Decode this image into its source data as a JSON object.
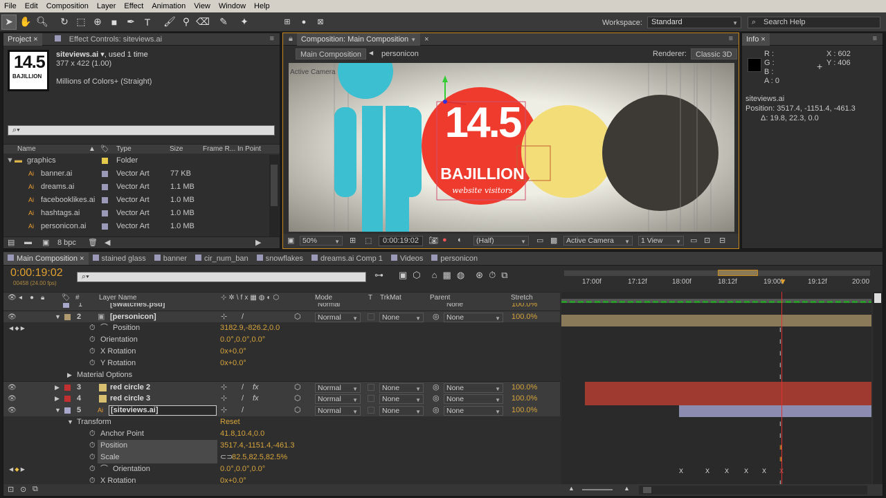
{
  "menu": [
    "File",
    "Edit",
    "Composition",
    "Layer",
    "Effect",
    "Animation",
    "View",
    "Window",
    "Help"
  ],
  "toolbar": {
    "workspace_label": "Workspace:",
    "workspace_value": "Standard",
    "search_placeholder": "Search Help"
  },
  "project": {
    "tab_project": "Project",
    "tab_effects": "Effect Controls: siteviews.ai",
    "thumb_number": "14.5",
    "thumb_word": "BAJILLION",
    "file_name": "siteviews.ai",
    "used": ", used 1 time",
    "dims": "377 x 422 (1.00)",
    "colors": "Millions of Colors+ (Straight)",
    "columns": {
      "name": "Name",
      "type": "Type",
      "size": "Size",
      "frame": "Frame R...",
      "inpoint": "In Point"
    },
    "items": [
      {
        "name": "graphics",
        "type": "Folder",
        "size": "",
        "color": "#e6c84a"
      },
      {
        "name": "banner.ai",
        "type": "Vector Art",
        "size": "77 KB",
        "color": "#9a9ab8"
      },
      {
        "name": "dreams.ai",
        "type": "Vector Art",
        "size": "1.1 MB",
        "color": "#9a9ab8"
      },
      {
        "name": "facebooklikes.ai",
        "type": "Vector Art",
        "size": "1.0 MB",
        "color": "#9a9ab8"
      },
      {
        "name": "hashtags.ai",
        "type": "Vector Art",
        "size": "1.0 MB",
        "color": "#9a9ab8"
      },
      {
        "name": "personicon.ai",
        "type": "Vector Art",
        "size": "1.0 MB",
        "color": "#9a9ab8"
      }
    ],
    "bpc": "8 bpc"
  },
  "comp": {
    "tab": "Composition: Main Composition",
    "crumb_main": "Main Composition",
    "crumb_person": "personicon",
    "renderer_label": "Renderer:",
    "renderer_value": "Classic 3D",
    "active_camera": "Active Camera",
    "big_number": "14.5",
    "big_word": "BAJILLION",
    "script_text": "website visitors",
    "zoom": "50%",
    "timecode": "0:00:19:02",
    "resolution": "(Half)",
    "camera_select": "Active Camera",
    "view_select": "1 View"
  },
  "info": {
    "tab": "Info",
    "r": "R :",
    "g": "G :",
    "b": "B :",
    "a": "A : 0",
    "x": "X : 602",
    "y": "Y : 406",
    "layer": "siteviews.ai",
    "position": "Position: 3517.4, -1151.4, -461.3",
    "delta": "Δ: 19.8, 22.3, 0.0"
  },
  "timeline": {
    "tabs": [
      "Main Composition",
      "stained glass",
      "banner",
      "cir_num_ban",
      "snowflakes",
      "dreams.ai Comp 1",
      "Videos",
      "personicon"
    ],
    "timecode": "0:00:19:02",
    "frames": "00458 (24.00 fps)",
    "ruler": [
      "17:00f",
      "17:12f",
      "18:00f",
      "18:12f",
      "19:00f",
      "19:12f",
      "20:00"
    ],
    "headers": {
      "num": "#",
      "layer_name": "Layer Name",
      "mode": "Mode",
      "t": "T",
      "trkmat": "TrkMat",
      "parent": "Parent",
      "stretch": "Stretch"
    },
    "layer1": {
      "num": "1",
      "name": "[swatches.psd]",
      "mode": "Normal",
      "parent": "None",
      "stretch": "100.0%"
    },
    "layer2": {
      "num": "2",
      "name": "[personicon]",
      "mode": "Normal",
      "trkmat": "None",
      "parent": "None",
      "stretch": "100.0%"
    },
    "l2props": [
      {
        "name": "Position",
        "value": "3182.9,-826.2,0.0"
      },
      {
        "name": "Orientation",
        "value": "0.0°,0.0°,0.0°"
      },
      {
        "name": "X Rotation",
        "value": "0x+0.0°"
      },
      {
        "name": "Y Rotation",
        "value": "0x+0.0°"
      }
    ],
    "material": "Material Options",
    "layer3": {
      "num": "3",
      "name": "red circle 2",
      "mode": "Normal",
      "trkmat": "None",
      "parent": "None",
      "stretch": "100.0%"
    },
    "layer4": {
      "num": "4",
      "name": "red circle 3",
      "mode": "Normal",
      "trkmat": "None",
      "parent": "None",
      "stretch": "100.0%"
    },
    "layer5": {
      "num": "5",
      "name": "[siteviews.ai]",
      "mode": "Normal",
      "trkmat": "None",
      "parent": "None",
      "stretch": "100.0%"
    },
    "transform": "Transform",
    "reset": "Reset",
    "l5props": [
      {
        "name": "Anchor Point",
        "value": "41.8,10.4,0.0"
      },
      {
        "name": "Position",
        "value": "3517.4,-1151.4,-461.3"
      },
      {
        "name": "Scale",
        "value": "82.5,82.5,82.5%"
      },
      {
        "name": "Orientation",
        "value": "0.0°,0.0°,0.0°"
      },
      {
        "name": "X Rotation",
        "value": "0x+0.0°"
      }
    ],
    "colors": {
      "red": "#c03030",
      "tan": "#b09a70",
      "lavender": "#a8a8cc"
    }
  }
}
